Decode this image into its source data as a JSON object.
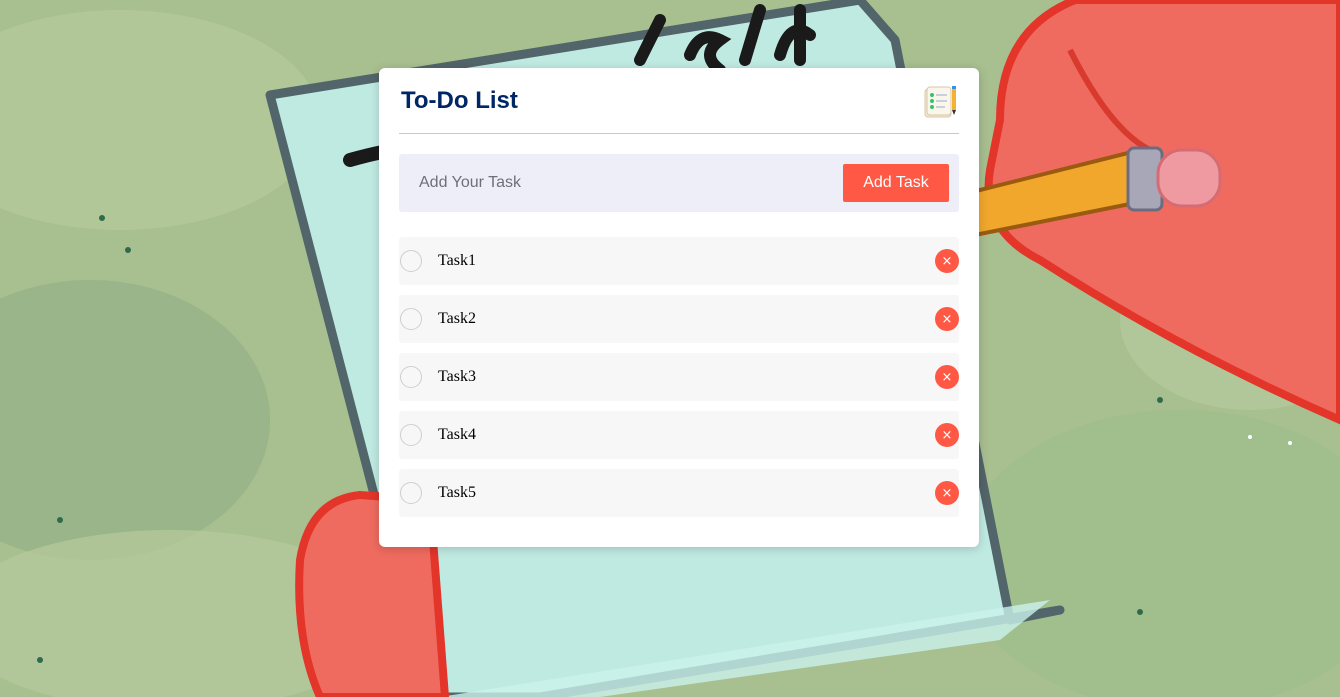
{
  "app": {
    "title": "To-Do List",
    "logo_icon": "checklist-notepad-icon"
  },
  "add_task": {
    "placeholder": "Add Your Task",
    "value": "",
    "button_label": "Add Task"
  },
  "tasks": [
    {
      "text": "Task1",
      "checked": false
    },
    {
      "text": "Task2",
      "checked": false
    },
    {
      "text": "Task3",
      "checked": false
    },
    {
      "text": "Task4",
      "checked": false
    },
    {
      "text": "Task5",
      "checked": false
    }
  ],
  "icons": {
    "delete": "close-icon",
    "delete_glyph": "×"
  },
  "colors": {
    "accent": "#ff5945",
    "title": "#002765",
    "input_bg": "#edeef8",
    "item_bg": "#f7f7f7"
  }
}
